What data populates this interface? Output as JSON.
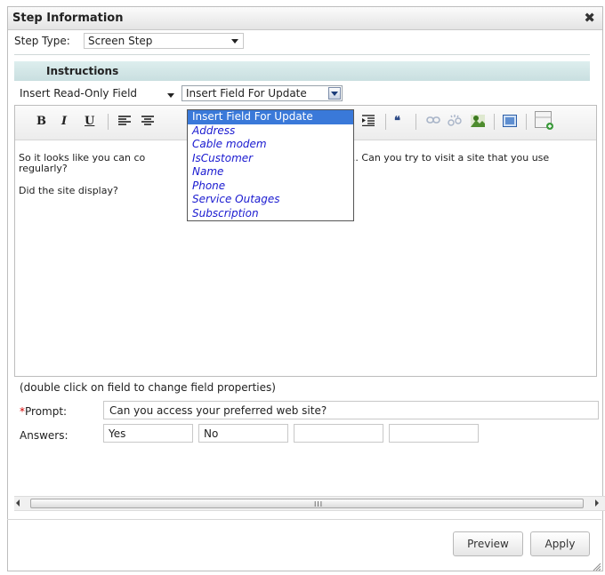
{
  "dialog": {
    "title": "Step Information",
    "close_glyph": "✖"
  },
  "step_type": {
    "label": "Step Type:",
    "value": "Screen Step"
  },
  "instructions": {
    "header": "Instructions",
    "insert_readonly_label": "Insert Read-Only Field",
    "insert_update_value": "Insert Field For Update"
  },
  "toolbar": {
    "bold": "B",
    "italic": "I",
    "underline": "U",
    "quote": "❝",
    "icons": [
      "bold-icon",
      "italic-icon",
      "underline-icon",
      "align-left-icon",
      "align-center-icon",
      "indent-icon",
      "blockquote-icon",
      "link-icon",
      "unlink-icon",
      "image-icon",
      "media-icon",
      "insert-table-icon"
    ]
  },
  "editor": {
    "paragraph1_part1": "So it looks like you can co",
    "paragraph1_part2": "t places... Can you try to visit a site that you use regularly?",
    "paragraph2": "Did the site display?"
  },
  "dropdown": {
    "options": [
      "Insert Field For Update",
      "Address",
      "Cable modem",
      "IsCustomer",
      "Name",
      "Phone",
      "Service Outages",
      "Subscription"
    ],
    "selected_index": 0
  },
  "form": {
    "hint": "(double click on field to change field properties)",
    "prompt_star": "*",
    "prompt_label": "Prompt:",
    "prompt_value": "Can you access your preferred web site?",
    "answers_label": "Answers:",
    "answers": [
      "Yes",
      "No",
      "",
      ""
    ]
  },
  "scrollbar": {
    "grip": "III"
  },
  "buttons": {
    "preview": "Preview",
    "apply": "Apply"
  },
  "colors": {
    "header_bg": "#c9dfe0",
    "dropdown_selected": "#3a79d9",
    "dropdown_item_text": "#1a1ad0",
    "required_star": "#d40000"
  }
}
